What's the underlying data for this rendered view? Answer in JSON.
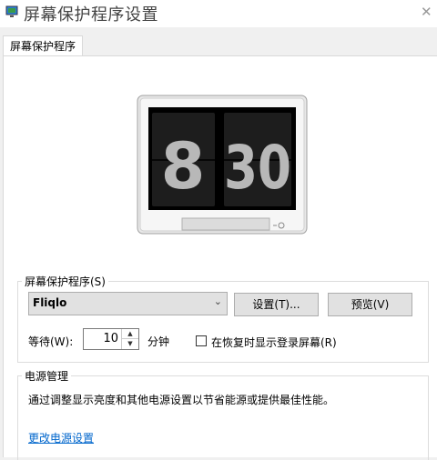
{
  "window": {
    "title": "屏幕保护程序设置",
    "close_icon": "close-icon"
  },
  "tabs": [
    {
      "label": "屏幕保护程序"
    }
  ],
  "preview": {
    "hour": "8",
    "minute": "30"
  },
  "screensaver": {
    "group_label": "屏幕保护程序(S)",
    "selected": "Fliqlo",
    "settings_label": "设置(T)...",
    "preview_label": "预览(V)",
    "wait_label": "等待(W):",
    "wait_value": "10",
    "minutes_label": "分钟",
    "resume_label": "在恢复时显示登录屏幕(R)",
    "resume_checked": false
  },
  "power": {
    "group_label": "电源管理",
    "description": "通过调整显示亮度和其他电源设置以节省能源或提供最佳性能。",
    "link_label": "更改电源设置"
  },
  "colors": {
    "link": "#0066cc",
    "accent": "#0078d7"
  }
}
